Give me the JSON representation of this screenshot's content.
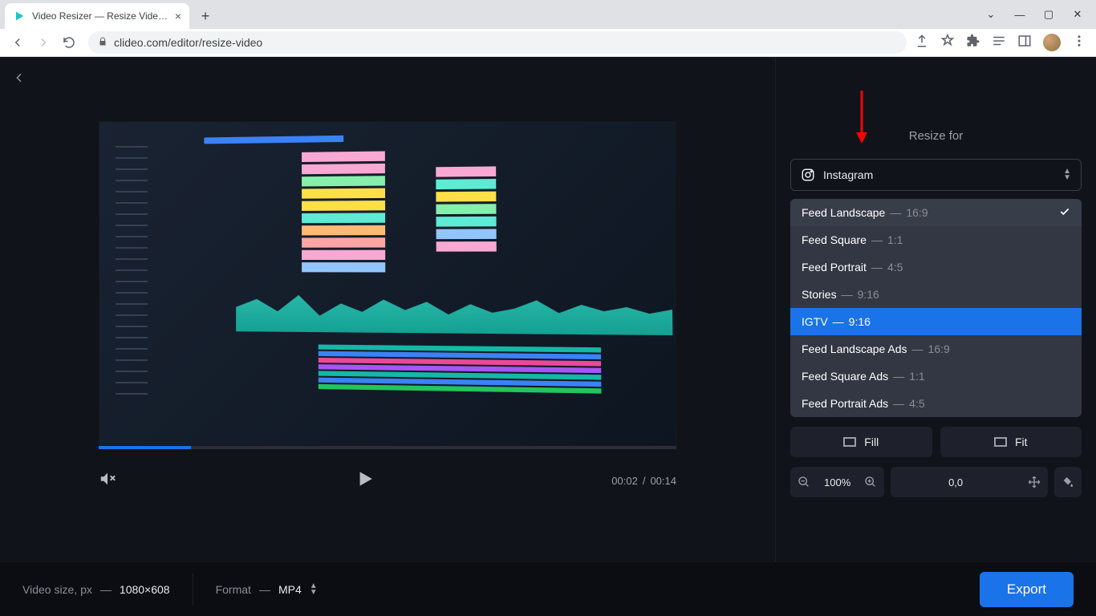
{
  "browser": {
    "tab_title": "Video Resizer — Resize Video On",
    "url": "clideo.com/editor/resize-video"
  },
  "player": {
    "current_time": "00:02",
    "duration": "00:14"
  },
  "panel": {
    "title": "Resize for",
    "platform": "Instagram",
    "options": [
      {
        "name": "Feed Landscape",
        "ratio": "16:9",
        "selected": true,
        "highlighted": false
      },
      {
        "name": "Feed Square",
        "ratio": "1:1",
        "selected": false,
        "highlighted": false
      },
      {
        "name": "Feed Portrait",
        "ratio": "4:5",
        "selected": false,
        "highlighted": false
      },
      {
        "name": "Stories",
        "ratio": "9:16",
        "selected": false,
        "highlighted": false
      },
      {
        "name": "IGTV",
        "ratio": "9:16",
        "selected": false,
        "highlighted": true
      },
      {
        "name": "Feed Landscape Ads",
        "ratio": "16:9",
        "selected": false,
        "highlighted": false
      },
      {
        "name": "Feed Square Ads",
        "ratio": "1:1",
        "selected": false,
        "highlighted": false
      },
      {
        "name": "Feed Portrait Ads",
        "ratio": "4:5",
        "selected": false,
        "highlighted": false
      }
    ],
    "fill_label": "Fill",
    "fit_label": "Fit",
    "zoom_value": "100%",
    "position_value": "0,0"
  },
  "bottombar": {
    "size_label": "Video size, px",
    "size_value": "1080×608",
    "format_label": "Format",
    "format_value": "MP4",
    "export_label": "Export"
  }
}
